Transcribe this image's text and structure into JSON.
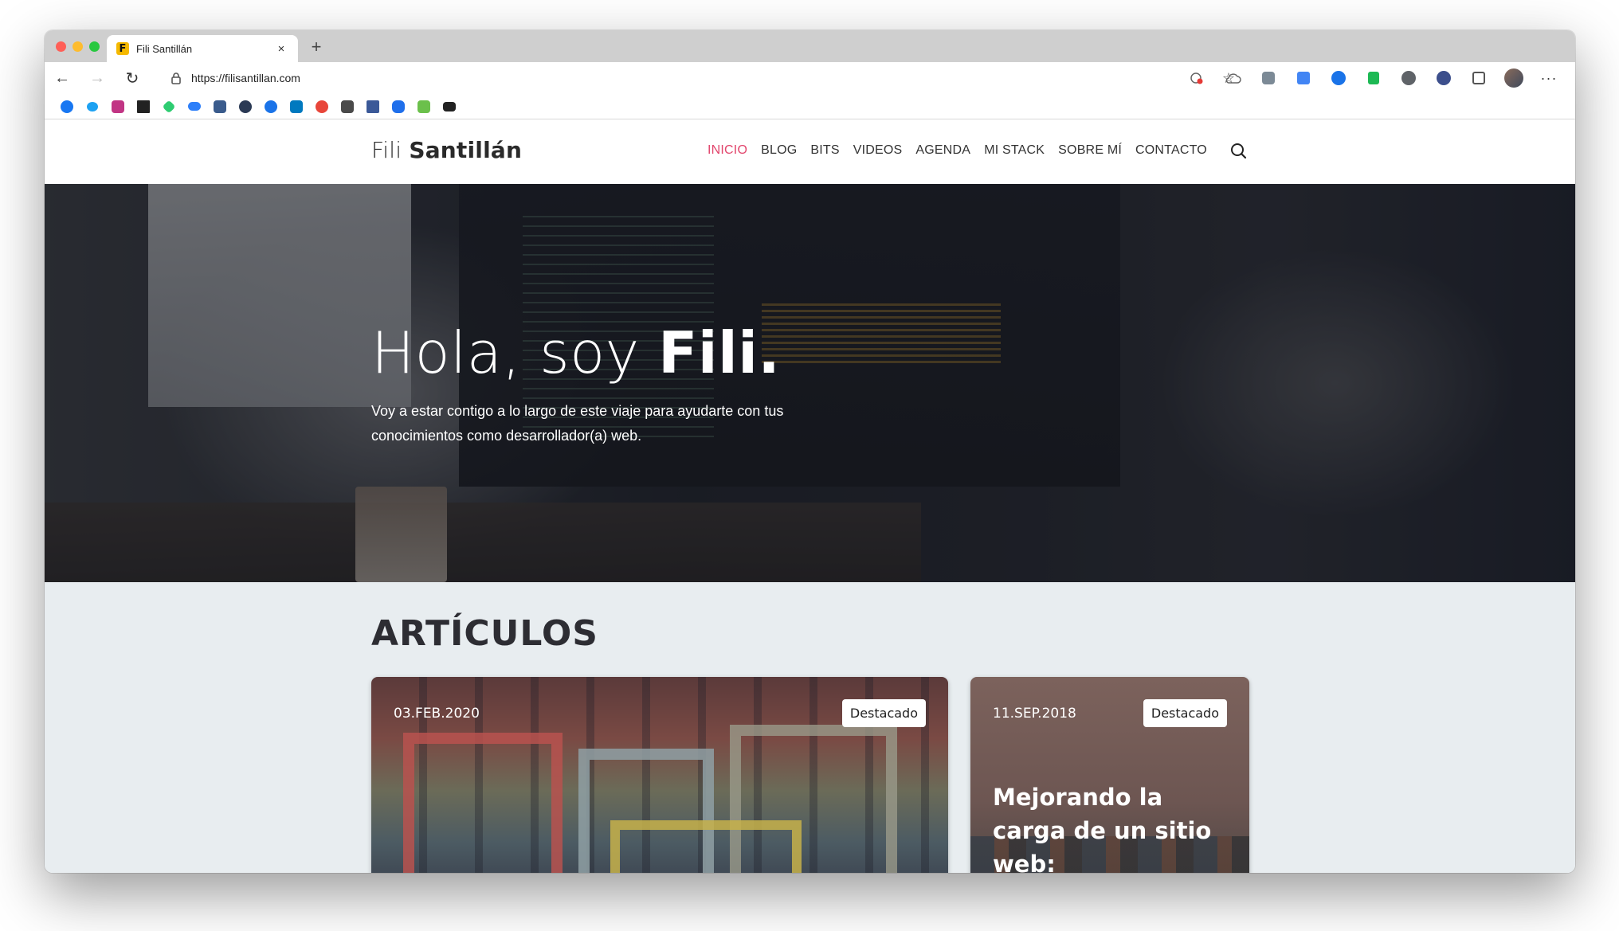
{
  "browser": {
    "tab": {
      "favicon_letter": "F",
      "title": "Fili Santillán",
      "close_glyph": "×"
    },
    "new_tab_glyph": "+",
    "nav": {
      "back_glyph": "←",
      "forward_glyph": "→",
      "reload_glyph": "↻"
    },
    "url": "https://filisantillan.com",
    "bookmark_star_glyph": "☆",
    "more_glyph": "···",
    "traffic_lights": [
      "#ff5f57",
      "#febc2e",
      "#28c840"
    ],
    "extension_colors": [
      "#9aa0a6",
      "#7c8a96",
      "#4285f4",
      "#1a73e8",
      "#1db954",
      "#5f6368",
      "#3c4f8c",
      "#5f6368"
    ],
    "bookmark_colors": [
      "#1877f2",
      "#1da1f2",
      "#c13584",
      "#222222",
      "#2ecc71",
      "#2d7ff9",
      "#3a5b8c",
      "#2b3a55",
      "#1a73e8",
      "#0079bf",
      "#e8463a",
      "#4a4a4a",
      "#3b5998",
      "#1f6feb",
      "#6bc04b",
      "#222222"
    ]
  },
  "site": {
    "logo": {
      "first": "Fili",
      "last": "Santillán"
    },
    "menu": [
      {
        "label": "INICIO",
        "active": true
      },
      {
        "label": "BLOG",
        "active": false
      },
      {
        "label": "BITS",
        "active": false
      },
      {
        "label": "VIDEOS",
        "active": false
      },
      {
        "label": "AGENDA",
        "active": false
      },
      {
        "label": "MI STACK",
        "active": false
      },
      {
        "label": "SOBRE MÍ",
        "active": false
      },
      {
        "label": "CONTACTO",
        "active": false
      }
    ],
    "accent_color": "#e2466d",
    "hero": {
      "title_light": "Hola, soy ",
      "title_bold": "Fili.",
      "subtitle": "Voy a estar contigo a lo largo de este viaje para ayudarte con tus conocimientos como desarrollador(a) web."
    },
    "articles": {
      "section_title": "ARTÍCULOS",
      "cards": [
        {
          "date": "03.FEB.2020",
          "badge": "Destacado",
          "title": ""
        },
        {
          "date": "11.SEP.2018",
          "badge": "Destacado",
          "title": "Mejorando la carga de un sitio web:"
        }
      ]
    }
  }
}
